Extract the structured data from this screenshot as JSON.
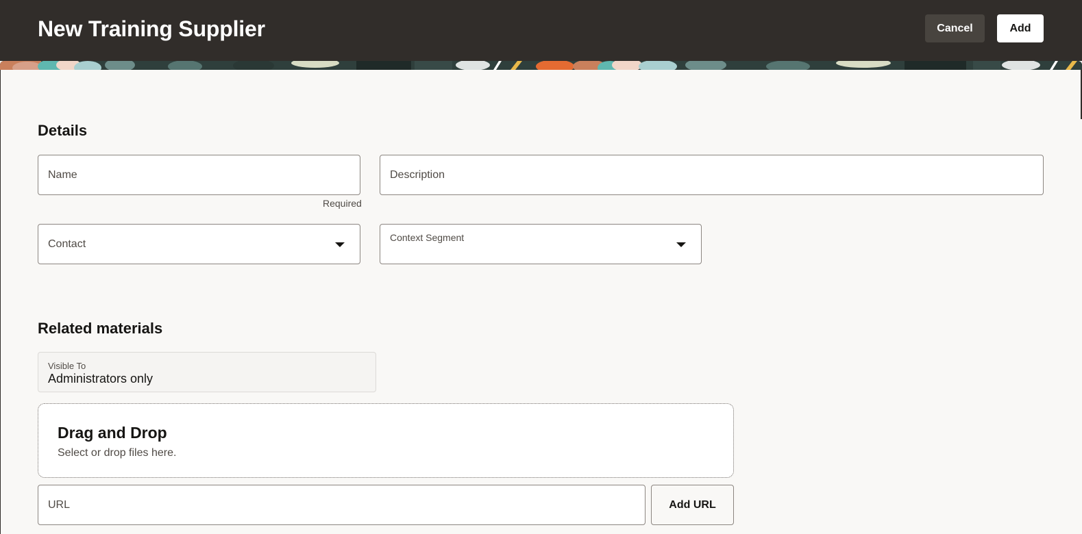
{
  "header": {
    "title": "New Training Supplier",
    "cancel_label": "Cancel",
    "add_label": "Add"
  },
  "details": {
    "section_title": "Details",
    "name_placeholder": "Name",
    "name_helper": "Required",
    "description_placeholder": "Description",
    "contact_placeholder": "Contact",
    "context_segment_label": "Context Segment"
  },
  "related": {
    "section_title": "Related materials",
    "visible_to_label": "Visible To",
    "visible_to_value": "Administrators only",
    "dropzone_title": "Drag and Drop",
    "dropzone_subtitle": "Select or drop files here.",
    "url_placeholder": "URL",
    "add_url_label": "Add URL"
  },
  "icons": {
    "contact_dropdown": "chevron-down-icon",
    "context_dropdown": "chevron-down-icon"
  },
  "colors": {
    "header_bg": "#312d2a",
    "page_bg": "#f9f8f6",
    "cancel_bg": "#48443f",
    "add_bg": "#ffffff"
  }
}
